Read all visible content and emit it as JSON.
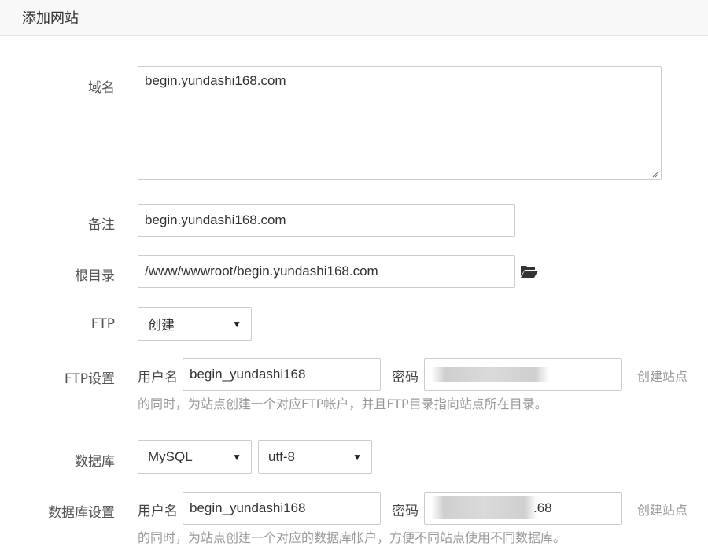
{
  "header": {
    "title": "添加网站"
  },
  "form": {
    "domain": {
      "label": "域名",
      "value": "begin.yundashi168.com"
    },
    "remark": {
      "label": "备注",
      "value": "begin.yundashi168.com"
    },
    "root": {
      "label": "根目录",
      "value": "/www/wwwroot/begin.yundashi168.com",
      "icon": "folder-open-icon"
    },
    "ftp": {
      "label": "FTP",
      "value": "创建"
    },
    "ftp_settings": {
      "label": "FTP设置",
      "user_label": "用户名",
      "user_value": "begin_yundashi168",
      "pass_label": "密码",
      "pass_fragment": "",
      "hint_line1": "创建站点",
      "hint_line2": "的同时，为站点创建一个对应FTP帐户，并且FTP目录指向站点所在目录。"
    },
    "database": {
      "label": "数据库",
      "type_value": "MySQL",
      "charset_value": "utf-8"
    },
    "db_settings": {
      "label": "数据库设置",
      "user_label": "用户名",
      "user_value": "begin_yundashi168",
      "pass_label": "密码",
      "pass_fragment": ".68",
      "hint_line1": "创建站点",
      "hint_line2": "的同时，为站点创建一个对应的数据库帐户，方便不同站点使用不同数据库。"
    }
  }
}
